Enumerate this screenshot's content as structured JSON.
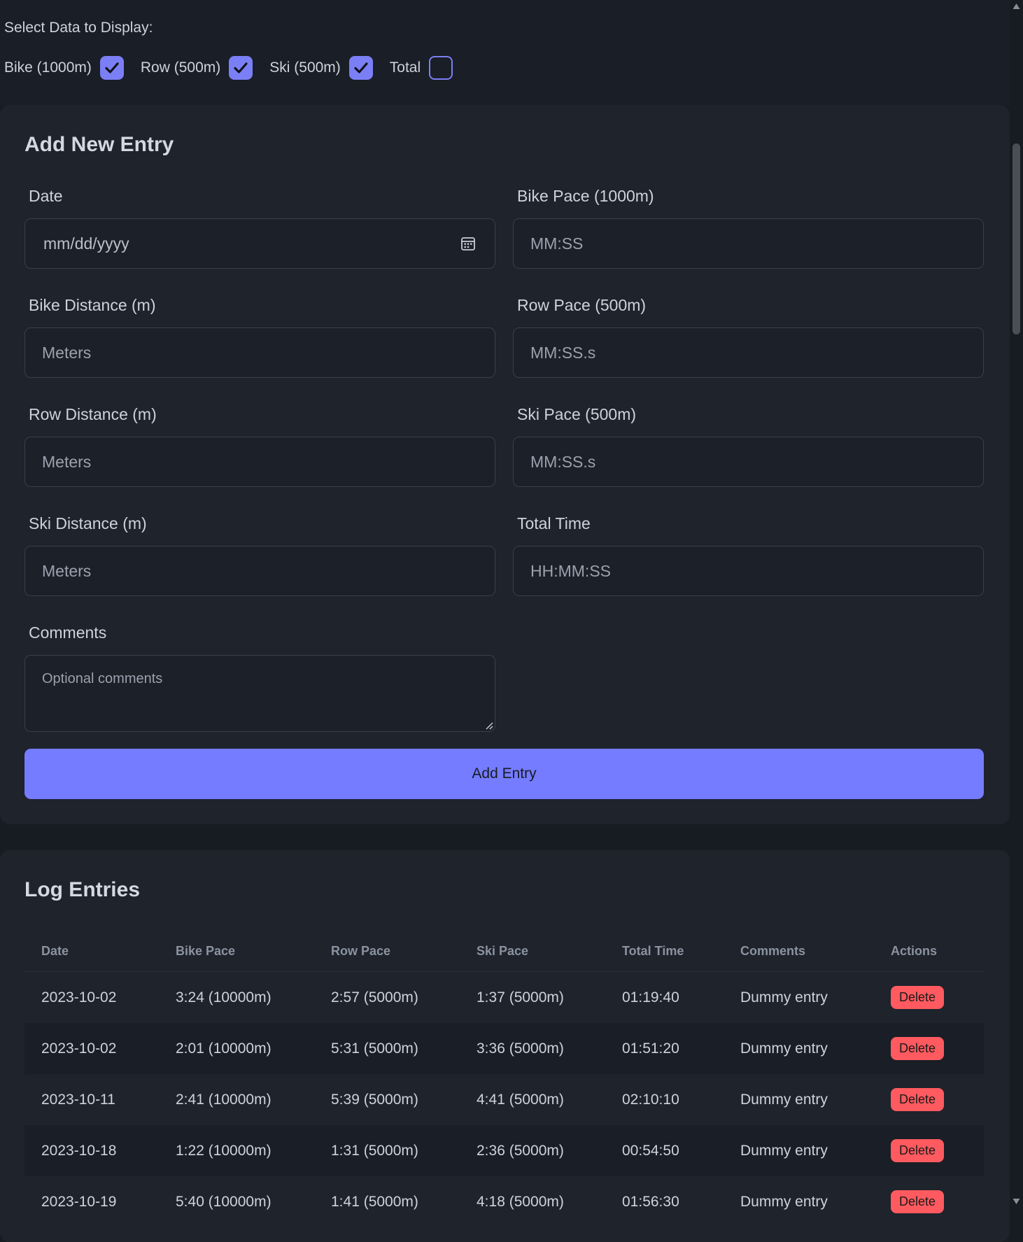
{
  "display": {
    "title": "Select Data to Display:",
    "toggles": [
      {
        "label": "Bike (1000m)",
        "checked": true
      },
      {
        "label": "Row (500m)",
        "checked": true
      },
      {
        "label": "Ski (500m)",
        "checked": true
      },
      {
        "label": "Total",
        "checked": false
      }
    ]
  },
  "form": {
    "title": "Add New Entry",
    "fields": {
      "date": {
        "label": "Date",
        "placeholder": "mm/dd/yyyy"
      },
      "bike_pace": {
        "label": "Bike Pace (1000m)",
        "placeholder": "MM:SS"
      },
      "bike_distance": {
        "label": "Bike Distance (m)",
        "placeholder": "Meters"
      },
      "row_pace": {
        "label": "Row Pace (500m)",
        "placeholder": "MM:SS.s"
      },
      "row_distance": {
        "label": "Row Distance (m)",
        "placeholder": "Meters"
      },
      "ski_pace": {
        "label": "Ski Pace (500m)",
        "placeholder": "MM:SS.s"
      },
      "ski_distance": {
        "label": "Ski Distance (m)",
        "placeholder": "Meters"
      },
      "total_time": {
        "label": "Total Time",
        "placeholder": "HH:MM:SS"
      },
      "comments": {
        "label": "Comments",
        "placeholder": "Optional comments"
      }
    },
    "submit_label": "Add Entry"
  },
  "log": {
    "title": "Log Entries",
    "columns": [
      "Date",
      "Bike Pace",
      "Row Pace",
      "Ski Pace",
      "Total Time",
      "Comments",
      "Actions"
    ],
    "delete_label": "Delete",
    "rows": [
      {
        "date": "2023-10-02",
        "bike": "3:24 (10000m)",
        "row": "2:57 (5000m)",
        "ski": "1:37 (5000m)",
        "total": "01:19:40",
        "comments": "Dummy entry"
      },
      {
        "date": "2023-10-02",
        "bike": "2:01 (10000m)",
        "row": "5:31 (5000m)",
        "ski": "3:36 (5000m)",
        "total": "01:51:20",
        "comments": "Dummy entry"
      },
      {
        "date": "2023-10-11",
        "bike": "2:41 (10000m)",
        "row": "5:39 (5000m)",
        "ski": "4:41 (5000m)",
        "total": "02:10:10",
        "comments": "Dummy entry"
      },
      {
        "date": "2023-10-18",
        "bike": "1:22 (10000m)",
        "row": "1:31 (5000m)",
        "ski": "2:36 (5000m)",
        "total": "00:54:50",
        "comments": "Dummy entry"
      },
      {
        "date": "2023-10-19",
        "bike": "5:40 (10000m)",
        "row": "1:41 (5000m)",
        "ski": "4:18 (5000m)",
        "total": "01:56:30",
        "comments": "Dummy entry"
      }
    ]
  },
  "colors": {
    "accent": "#757cff",
    "delete": "#ff5a5f",
    "background": "#171b22",
    "card": "#1e232c"
  },
  "icons": {
    "checkmark": "check-icon",
    "calendar": "calendar-icon"
  }
}
